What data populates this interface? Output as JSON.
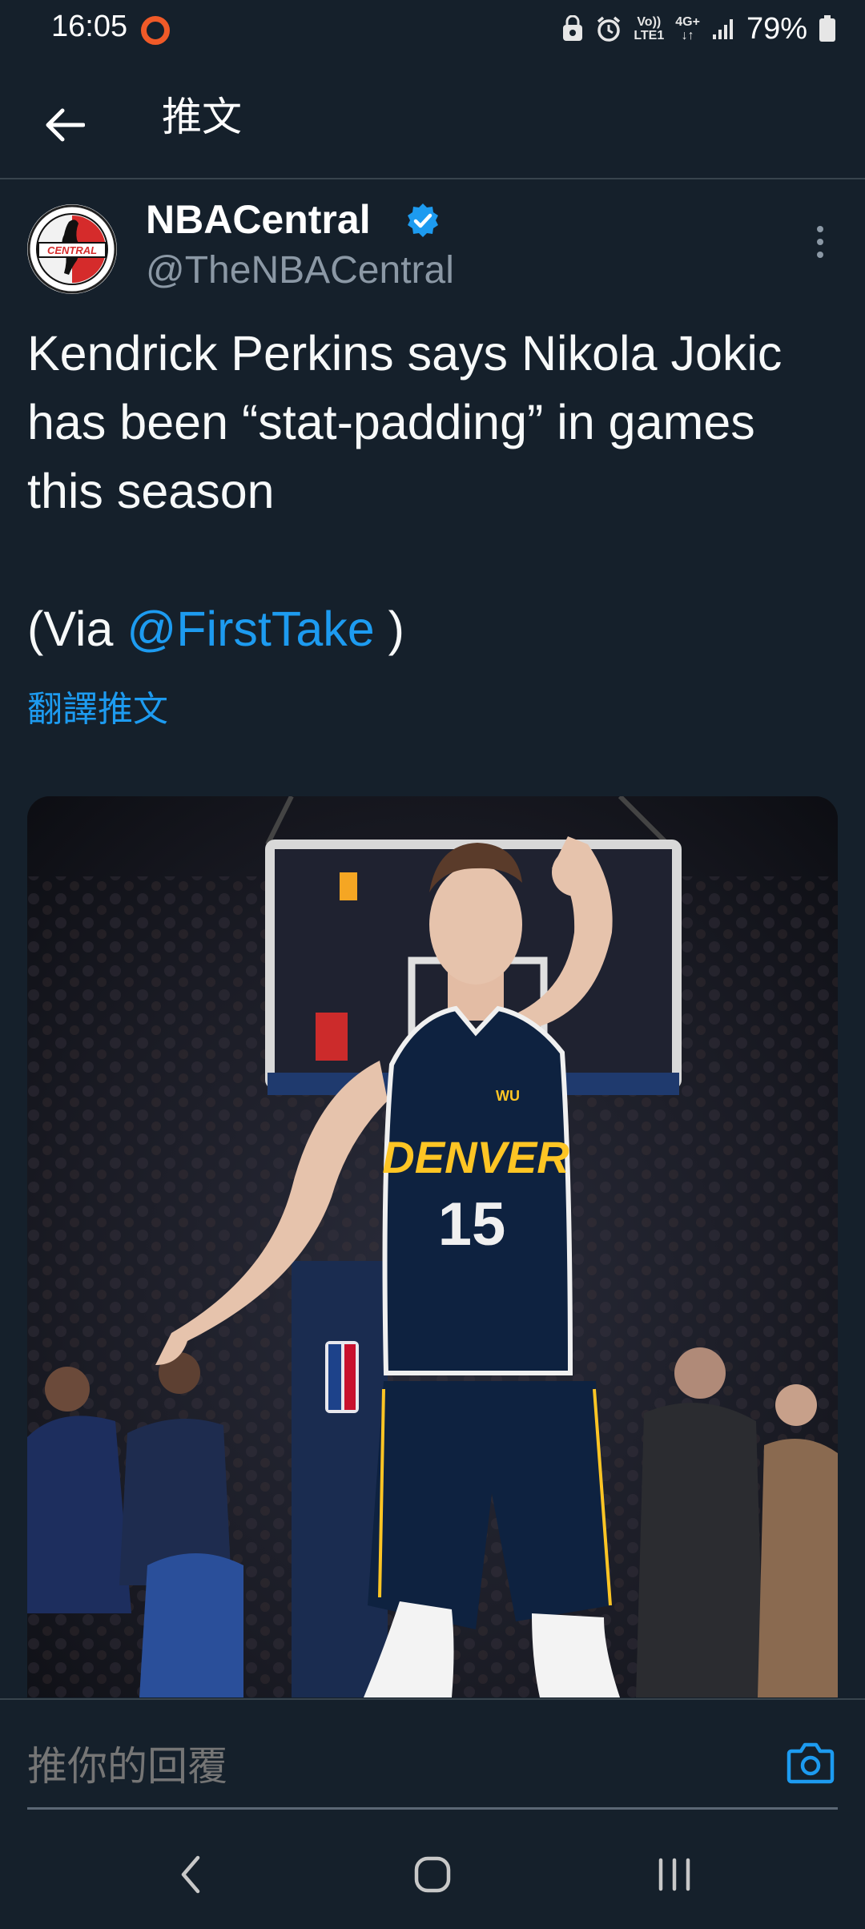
{
  "status_bar": {
    "time": "16:05",
    "net_top": "Vo))",
    "net_bottom": "LTE1",
    "net_type": "4G+",
    "battery": "79%",
    "icons": [
      "recorder-ring-icon",
      "lock-alt-icon",
      "alarm-icon",
      "volte-icon",
      "4g-icon",
      "signal-icon",
      "battery-icon"
    ]
  },
  "header": {
    "title": "推文",
    "back_icon": "arrow-left-icon"
  },
  "tweet": {
    "display_name": "NBACentral",
    "handle": "@TheNBACentral",
    "avatar_text": "CENTRAL",
    "text": "Kendrick Perkins says Nikola Jokic has been “stat-padding” in games this season",
    "via_prefix": "(Via ",
    "via_mention": "@FirstTake",
    "via_suffix": " )",
    "translate": "翻譯推文",
    "media": {
      "jersey_team": "DENVER",
      "jersey_number": "15",
      "patch": "WU"
    }
  },
  "reply": {
    "placeholder": "推你的回覆",
    "camera_icon": "camera-icon"
  },
  "colors": {
    "background": "#15202b",
    "accent": "#1d9bf0",
    "muted": "#8b98a5",
    "jersey": "#0e2240",
    "jersey_gold": "#fec524"
  }
}
